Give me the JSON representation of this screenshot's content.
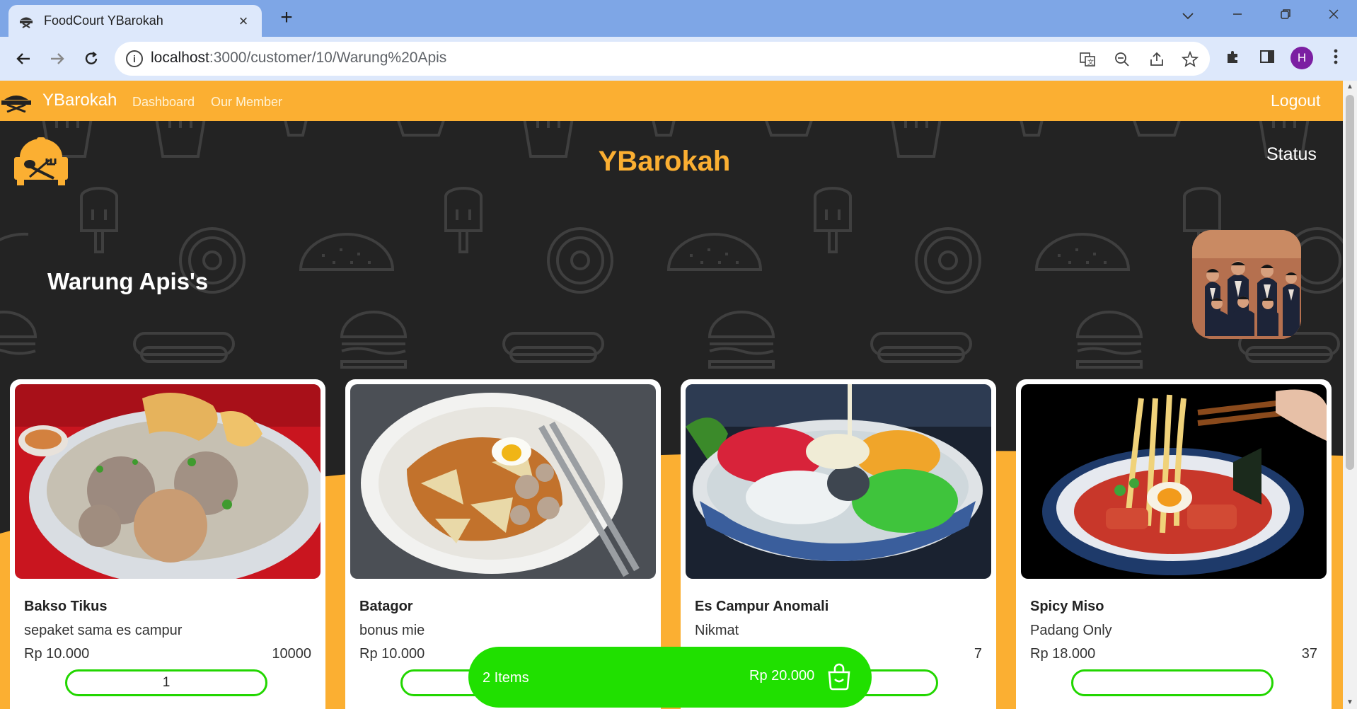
{
  "browser": {
    "tab_title": "FoodCourt YBarokah",
    "tab_close": "×",
    "new_tab": "+",
    "url_host": "localhost",
    "url_rest": ":3000/customer/10/Warung%20Apis",
    "info_icon": "i",
    "profile_initial": "H"
  },
  "navbar": {
    "brand": "YBarokah",
    "links": [
      "Dashboard",
      "Our Member"
    ],
    "logout": "Logout"
  },
  "hero": {
    "title": "YBarokah",
    "status": "Status",
    "warung_name": "Warung Apis's"
  },
  "menu": [
    {
      "name": "Bakso Tikus",
      "desc": "sepaket sama es campur",
      "price": "Rp 10.000",
      "stock": "10000",
      "qty": "1"
    },
    {
      "name": "Batagor",
      "desc": "bonus mie",
      "price": "Rp 10.000",
      "stock": "",
      "qty": ""
    },
    {
      "name": "Es Campur Anomali",
      "desc": "Nikmat",
      "price": "",
      "stock": "7",
      "qty": ""
    },
    {
      "name": "Spicy Miso",
      "desc": "Padang Only",
      "price": "Rp 18.000",
      "stock": "37",
      "qty": ""
    }
  ],
  "cart": {
    "items": "2 Items",
    "total": "Rp 20.000"
  },
  "colors": {
    "accent": "#fbaf32",
    "cart_green": "#20e000",
    "page_bg": "#232323"
  },
  "icons": {
    "nav_back": "arrow-left-icon",
    "nav_forward": "arrow-right-icon",
    "reload": "reload-icon",
    "translate": "translate-icon",
    "zoom": "zoom-out-icon",
    "share": "share-icon",
    "bookmark": "star-icon",
    "extensions": "puzzle-icon",
    "sidepanel": "side-panel-icon",
    "menu": "kebab-menu-icon",
    "cart": "shopping-bag-icon"
  }
}
